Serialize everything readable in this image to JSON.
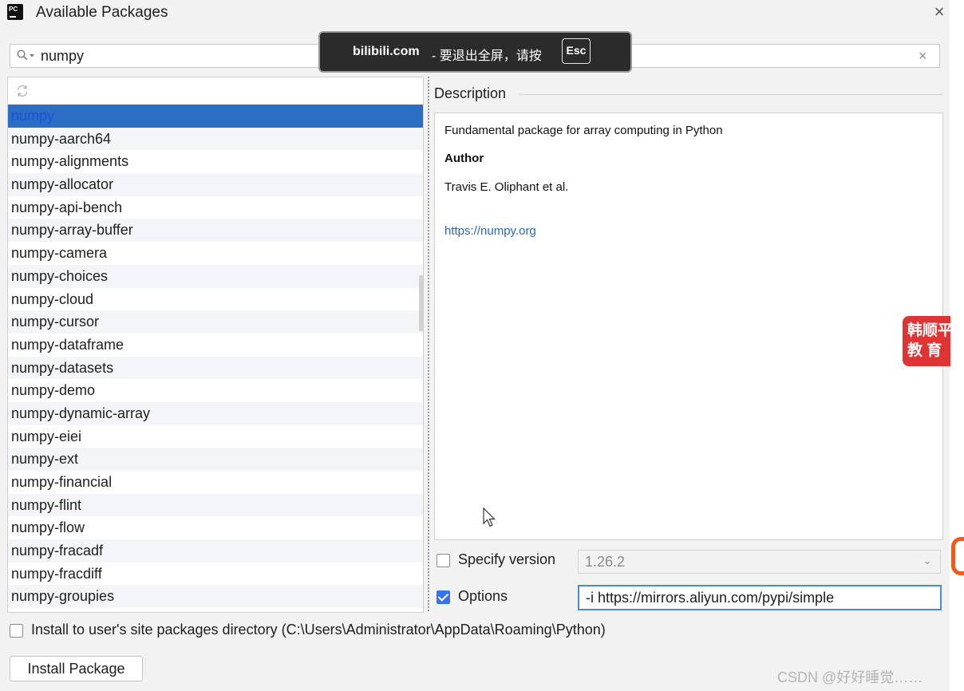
{
  "window": {
    "title": "Available Packages",
    "close_glyph": "×",
    "app_icon_text": "PC"
  },
  "search": {
    "value": "numpy",
    "clear_glyph": "×"
  },
  "packages": [
    "numpy",
    "numpy-aarch64",
    "numpy-alignments",
    "numpy-allocator",
    "numpy-api-bench",
    "numpy-array-buffer",
    "numpy-camera",
    "numpy-choices",
    "numpy-cloud",
    "numpy-cursor",
    "numpy-dataframe",
    "numpy-datasets",
    "numpy-demo",
    "numpy-dynamic-array",
    "numpy-eiei",
    "numpy-ext",
    "numpy-financial",
    "numpy-flint",
    "numpy-flow",
    "numpy-fracadf",
    "numpy-fracdiff",
    "numpy-groupies"
  ],
  "selected_index": 0,
  "description": {
    "label": "Description",
    "summary": "Fundamental package for array computing in Python",
    "author_heading": "Author",
    "author": "Travis E. Oliphant et al.",
    "link": "https://numpy.org"
  },
  "specify_version": {
    "label": "Specify version",
    "checked": false,
    "value": "1.26.2",
    "chevron": "⌄"
  },
  "options": {
    "label": "Options",
    "checked": true,
    "value": "-i https://mirrors.aliyun.com/pypi/simple"
  },
  "user_site": {
    "label": "Install to user's site packages directory (C:\\Users\\Administrator\\AppData\\Roaming\\Python)",
    "checked": false
  },
  "install_button": {
    "label": "Install Package"
  },
  "overlay": {
    "site": "bilibili.com",
    "message": "- 要退出全屏，请按",
    "key": "Esc"
  },
  "watermark": {
    "badge_line1": "韩顺平",
    "badge_line2": "教 育",
    "csdn": "CSDN @好好睡觉……"
  },
  "colors": {
    "selection": "#2a6fc4",
    "accent": "#3574f0",
    "link": "#2a66b8",
    "badge": "#e03333"
  }
}
